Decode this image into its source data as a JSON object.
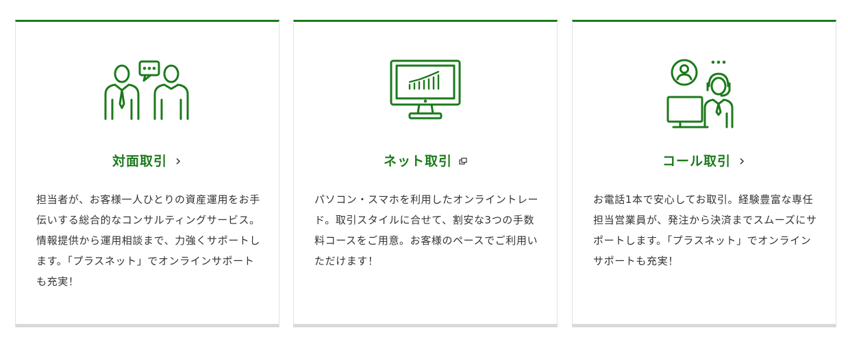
{
  "brand_color": "#1a7a1a",
  "cards": [
    {
      "icon": "face-to-face-consultation-icon",
      "title": "対面取引",
      "title_icon": "chevron-right-icon",
      "description": "担当者が、お客様一人ひとりの資産運用をお手伝いする総合的なコンサルティングサービス。情報提供から運用相談まで、力強くサポートします。「プラスネット」でオンラインサポートも充実！"
    },
    {
      "icon": "monitor-chart-icon",
      "title": "ネット取引",
      "title_icon": "external-link-icon",
      "description": "パソコン・スマホを利用したオンライントレード。取引スタイルに合せて、割安な3つの手数料コースをご用意。お客様のペースでご利用いただけます！"
    },
    {
      "icon": "call-center-operator-icon",
      "title": "コール取引",
      "title_icon": "chevron-right-icon",
      "description": "お電話1本で安心してお取引。経験豊富な専任担当営業員が、発注から決済までスムーズにサポートします。「プラスネット」でオンラインサポートも充実！"
    }
  ]
}
